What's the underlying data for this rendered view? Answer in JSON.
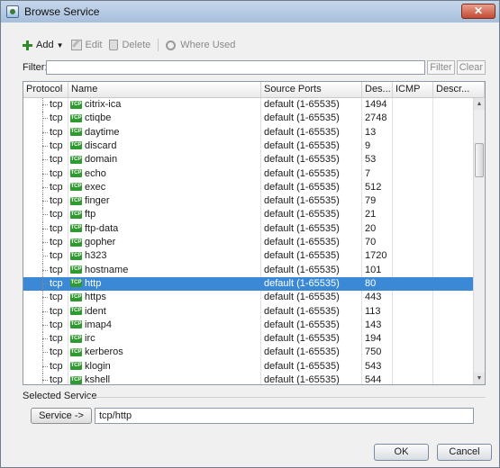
{
  "window": {
    "title": "Browse Service",
    "close_glyph": "✕"
  },
  "toolbar": {
    "add_label": "Add",
    "edit_label": "Edit",
    "delete_label": "Delete",
    "where_used_label": "Where Used"
  },
  "filter": {
    "label": "Filter:",
    "filter_button": "Filter",
    "clear_button": "Clear",
    "value": ""
  },
  "table": {
    "columns": [
      "Protocol",
      "Name",
      "Source Ports",
      "Des...",
      "ICMP",
      "Descr..."
    ],
    "rows": [
      {
        "protocol": "tcp",
        "name": "citrix-ica",
        "source_ports": "default (1-65535)",
        "dest": "1494"
      },
      {
        "protocol": "tcp",
        "name": "ctiqbe",
        "source_ports": "default (1-65535)",
        "dest": "2748"
      },
      {
        "protocol": "tcp",
        "name": "daytime",
        "source_ports": "default (1-65535)",
        "dest": "13"
      },
      {
        "protocol": "tcp",
        "name": "discard",
        "source_ports": "default (1-65535)",
        "dest": "9"
      },
      {
        "protocol": "tcp",
        "name": "domain",
        "source_ports": "default (1-65535)",
        "dest": "53"
      },
      {
        "protocol": "tcp",
        "name": "echo",
        "source_ports": "default (1-65535)",
        "dest": "7"
      },
      {
        "protocol": "tcp",
        "name": "exec",
        "source_ports": "default (1-65535)",
        "dest": "512"
      },
      {
        "protocol": "tcp",
        "name": "finger",
        "source_ports": "default (1-65535)",
        "dest": "79"
      },
      {
        "protocol": "tcp",
        "name": "ftp",
        "source_ports": "default (1-65535)",
        "dest": "21"
      },
      {
        "protocol": "tcp",
        "name": "ftp-data",
        "source_ports": "default (1-65535)",
        "dest": "20"
      },
      {
        "protocol": "tcp",
        "name": "gopher",
        "source_ports": "default (1-65535)",
        "dest": "70"
      },
      {
        "protocol": "tcp",
        "name": "h323",
        "source_ports": "default (1-65535)",
        "dest": "1720"
      },
      {
        "protocol": "tcp",
        "name": "hostname",
        "source_ports": "default (1-65535)",
        "dest": "101"
      },
      {
        "protocol": "tcp",
        "name": "http",
        "source_ports": "default (1-65535)",
        "dest": "80",
        "selected": true
      },
      {
        "protocol": "tcp",
        "name": "https",
        "source_ports": "default (1-65535)",
        "dest": "443"
      },
      {
        "protocol": "tcp",
        "name": "ident",
        "source_ports": "default (1-65535)",
        "dest": "113"
      },
      {
        "protocol": "tcp",
        "name": "imap4",
        "source_ports": "default (1-65535)",
        "dest": "143"
      },
      {
        "protocol": "tcp",
        "name": "irc",
        "source_ports": "default (1-65535)",
        "dest": "194"
      },
      {
        "protocol": "tcp",
        "name": "kerberos",
        "source_ports": "default (1-65535)",
        "dest": "750"
      },
      {
        "protocol": "tcp",
        "name": "klogin",
        "source_ports": "default (1-65535)",
        "dest": "543"
      },
      {
        "protocol": "tcp",
        "name": "kshell",
        "source_ports": "default (1-65535)",
        "dest": "544"
      }
    ],
    "protocol_icon_text": "TCP",
    "selected_row_color": "#3a88d6"
  },
  "selected_service": {
    "label": "Selected Service",
    "button_label": "Service ->",
    "value": "tcp/http"
  },
  "dialog_buttons": {
    "ok": "OK",
    "cancel": "Cancel"
  }
}
